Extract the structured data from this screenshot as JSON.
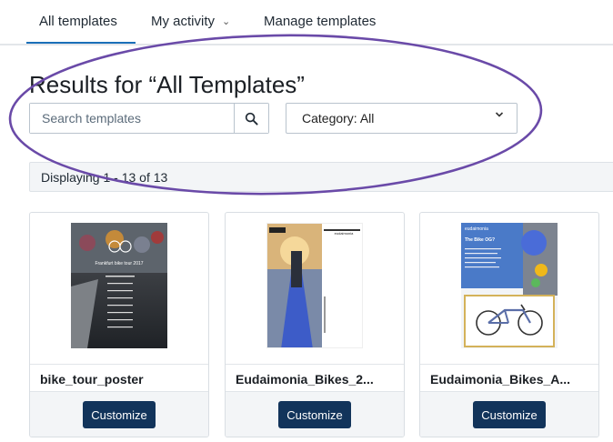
{
  "tabs": [
    {
      "label": "All templates",
      "active": true
    },
    {
      "label": "My activity",
      "has_dropdown": true
    },
    {
      "label": "Manage templates"
    }
  ],
  "page_title": "Results for “All Templates”",
  "search": {
    "placeholder": "Search templates",
    "value": ""
  },
  "category": {
    "label": "Category: All"
  },
  "results": {
    "text": "Displaying 1 - 13 of 13"
  },
  "templates": [
    {
      "name": "bike_tour_poster",
      "button_label": "Customize",
      "thumbnail_title": "Frankfurt bike tour 2017"
    },
    {
      "name": "Eudaimonia_Bikes_2...",
      "button_label": "Customize",
      "thumbnail_brand": "eudaimonia"
    },
    {
      "name": "Eudaimonia_Bikes_A...",
      "button_label": "Customize",
      "thumbnail_brand": "eudaimonia",
      "thumbnail_headline": "The Bike OG?"
    }
  ],
  "colors": {
    "accent": "#1a6fb8",
    "button": "#12345b",
    "annotation": "#6a4aa8"
  },
  "icons": {
    "search": "search-icon",
    "dropdown": "chevron-down-icon"
  }
}
